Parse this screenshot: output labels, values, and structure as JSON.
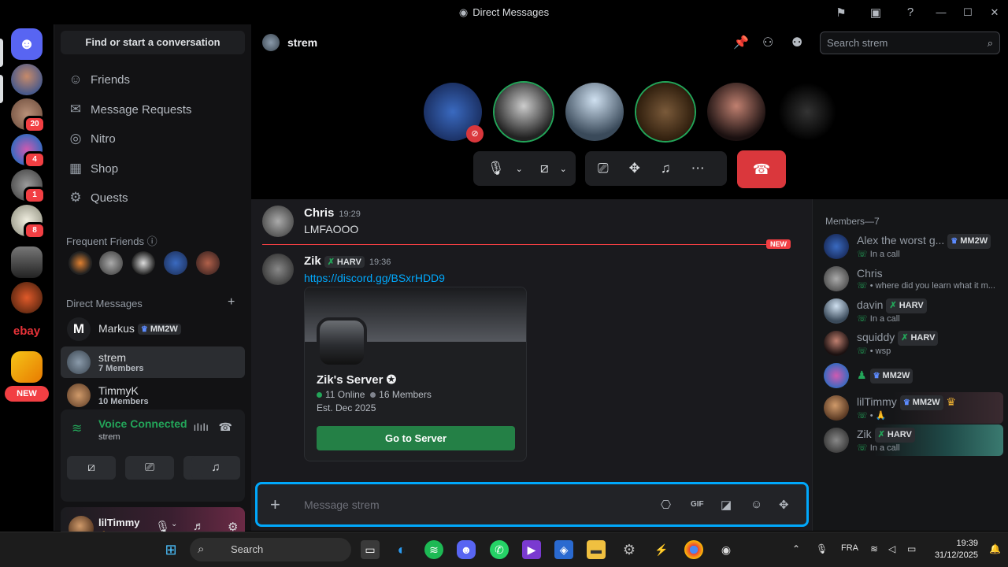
{
  "window": {
    "title": "Direct Messages"
  },
  "rail": {
    "badges": [
      "20",
      "4",
      "1",
      "8"
    ],
    "ebay": "ebay",
    "new_label": "NEW"
  },
  "sidebar": {
    "find_placeholder": "Find or start a conversation",
    "nav": [
      {
        "label": "Friends",
        "icon": "friends-icon"
      },
      {
        "label": "Message Requests",
        "icon": "mail-icon"
      },
      {
        "label": "Nitro",
        "icon": "nitro-icon"
      },
      {
        "label": "Shop",
        "icon": "shop-icon"
      },
      {
        "label": "Quests",
        "icon": "quests-icon"
      }
    ],
    "frequent_friends_label": "Frequent Friends",
    "direct_messages_label": "Direct Messages",
    "dms": [
      {
        "name": "Markus",
        "tag": "MM2W"
      },
      {
        "name": "strem",
        "sub": "7 Members"
      },
      {
        "name": "TimmyK",
        "sub": "10 Members"
      }
    ]
  },
  "voice": {
    "status": "Voice Connected",
    "channel": "strem"
  },
  "user": {
    "name": "lilTimmy",
    "status": "🙏"
  },
  "channel": {
    "name": "strem",
    "search_placeholder": "Search strem"
  },
  "messages": [
    {
      "author": "Chris",
      "time": "19:29",
      "text": "LMFAOOO"
    },
    {
      "author": "Zik",
      "tag": "HARV",
      "time": "19:36",
      "text": "https://discord.gg/BSxrHDD9"
    }
  ],
  "new_marker": "NEW",
  "invite": {
    "server_name": "Zik's Server",
    "online": "11 Online",
    "members": "16 Members",
    "established": "Est. Dec 2025",
    "button": "Go to Server"
  },
  "members_panel": {
    "header": "Members—7",
    "list": [
      {
        "name": "Alex the worst g...",
        "tag": "MM2W",
        "status": "In a call"
      },
      {
        "name": "Chris",
        "tag": "",
        "status": "• where did you learn what it m..."
      },
      {
        "name": "davin",
        "tag": "HARV",
        "status": "In a call"
      },
      {
        "name": "squiddy",
        "tag": "HARV",
        "status": "• wsp"
      },
      {
        "name": "",
        "tag": "MM2W",
        "status": ""
      },
      {
        "name": "lilTimmy",
        "tag": "MM2W",
        "status": "• 🙏"
      },
      {
        "name": "Zik",
        "tag": "HARV",
        "status": "In a call"
      }
    ]
  },
  "composer": {
    "placeholder": "Message strem"
  },
  "taskbar": {
    "search": "Search",
    "lang": "FRA",
    "time": "19:39",
    "date": "31/12/2025"
  },
  "colors": {
    "accent": "#5865f2",
    "online": "#23a559",
    "danger": "#da373c",
    "link": "#00a8fc",
    "focus": "#00a8fc"
  }
}
